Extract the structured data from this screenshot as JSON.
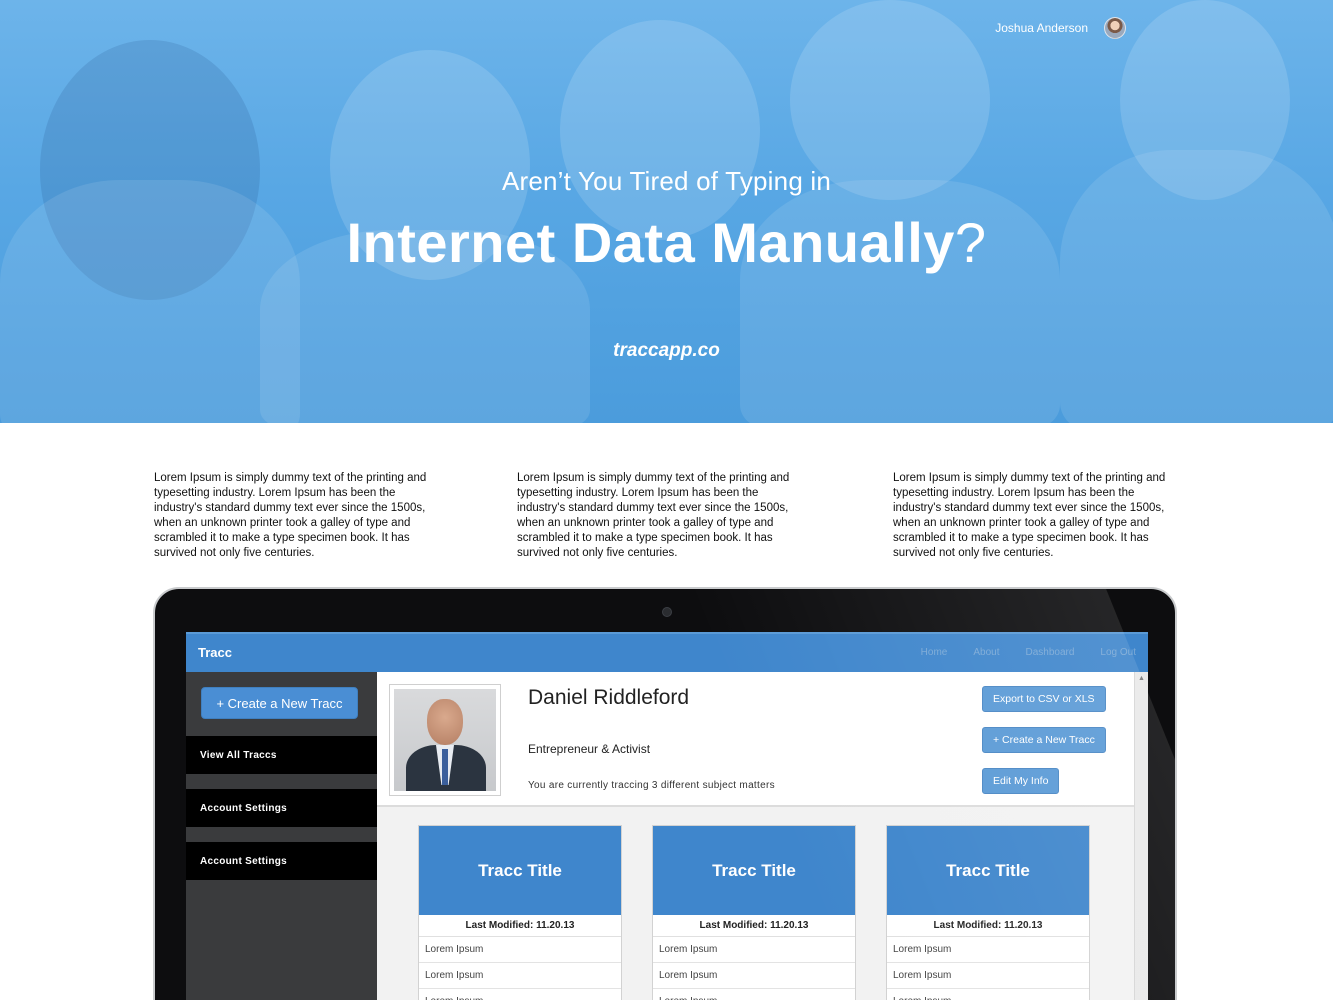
{
  "hero": {
    "user_name": "Joshua Anderson",
    "subtitle": "Aren’t You Tired of Typing in",
    "title": "Internet Data Manually",
    "title_mark": "?",
    "url": "traccapp.co"
  },
  "columns": [
    "Lorem Ipsum is simply dummy text of the printing and typesetting industry. Lorem Ipsum has been the industry's standard dummy text ever since the 1500s, when an unknown printer took a galley of type and scrambled it to make a type specimen book. It has survived not only five centuries.",
    "Lorem Ipsum is simply dummy text of the printing and typesetting industry. Lorem Ipsum has been the industry's standard dummy text ever since the 1500s, when an unknown printer took a galley of type and scrambled it to make a type specimen book. It has survived not only five centuries.",
    "Lorem Ipsum is simply dummy text of the printing and typesetting industry. Lorem Ipsum has been the industry's standard dummy text ever since the 1500s, when an unknown printer took a galley of type and scrambled it to make a type specimen book. It has survived not only five centuries."
  ],
  "app": {
    "brand": "Tracc",
    "nav": [
      "Home",
      "About",
      "Dashboard",
      "Log Out"
    ],
    "sidebar": {
      "create_button": "+ Create a New Tracc",
      "items": [
        "View All Traccs",
        "Account Settings",
        "Account Settings"
      ]
    },
    "profile": {
      "name": "Daniel Riddleford",
      "role": "Entrepreneur & Activist",
      "note": "You are currently traccing 3 different subject matters",
      "actions": [
        "Export to CSV or XLS",
        "+ Create a New Tracc",
        "Edit My Info"
      ]
    },
    "cards": [
      {
        "title": "Tracc Title",
        "modified": "Last Modified: 11.20.13",
        "rows": [
          "Lorem Ipsum",
          "Lorem Ipsum",
          "Lorem Ipsum"
        ]
      },
      {
        "title": "Tracc Title",
        "modified": "Last Modified: 11.20.13",
        "rows": [
          "Lorem Ipsum",
          "Lorem Ipsum",
          "Lorem Ipsum"
        ]
      },
      {
        "title": "Tracc Title",
        "modified": "Last Modified: 11.20.13",
        "rows": [
          "Lorem Ipsum",
          "Lorem Ipsum",
          "Lorem Ipsum"
        ]
      }
    ]
  },
  "colors": {
    "hero_blue": "#58a7e4",
    "app_blue": "#3f86cc",
    "button_blue": "#5a9ad6",
    "sidebar_dark": "#3a3b3d"
  },
  "icons": [
    "avatar",
    "camera"
  ]
}
